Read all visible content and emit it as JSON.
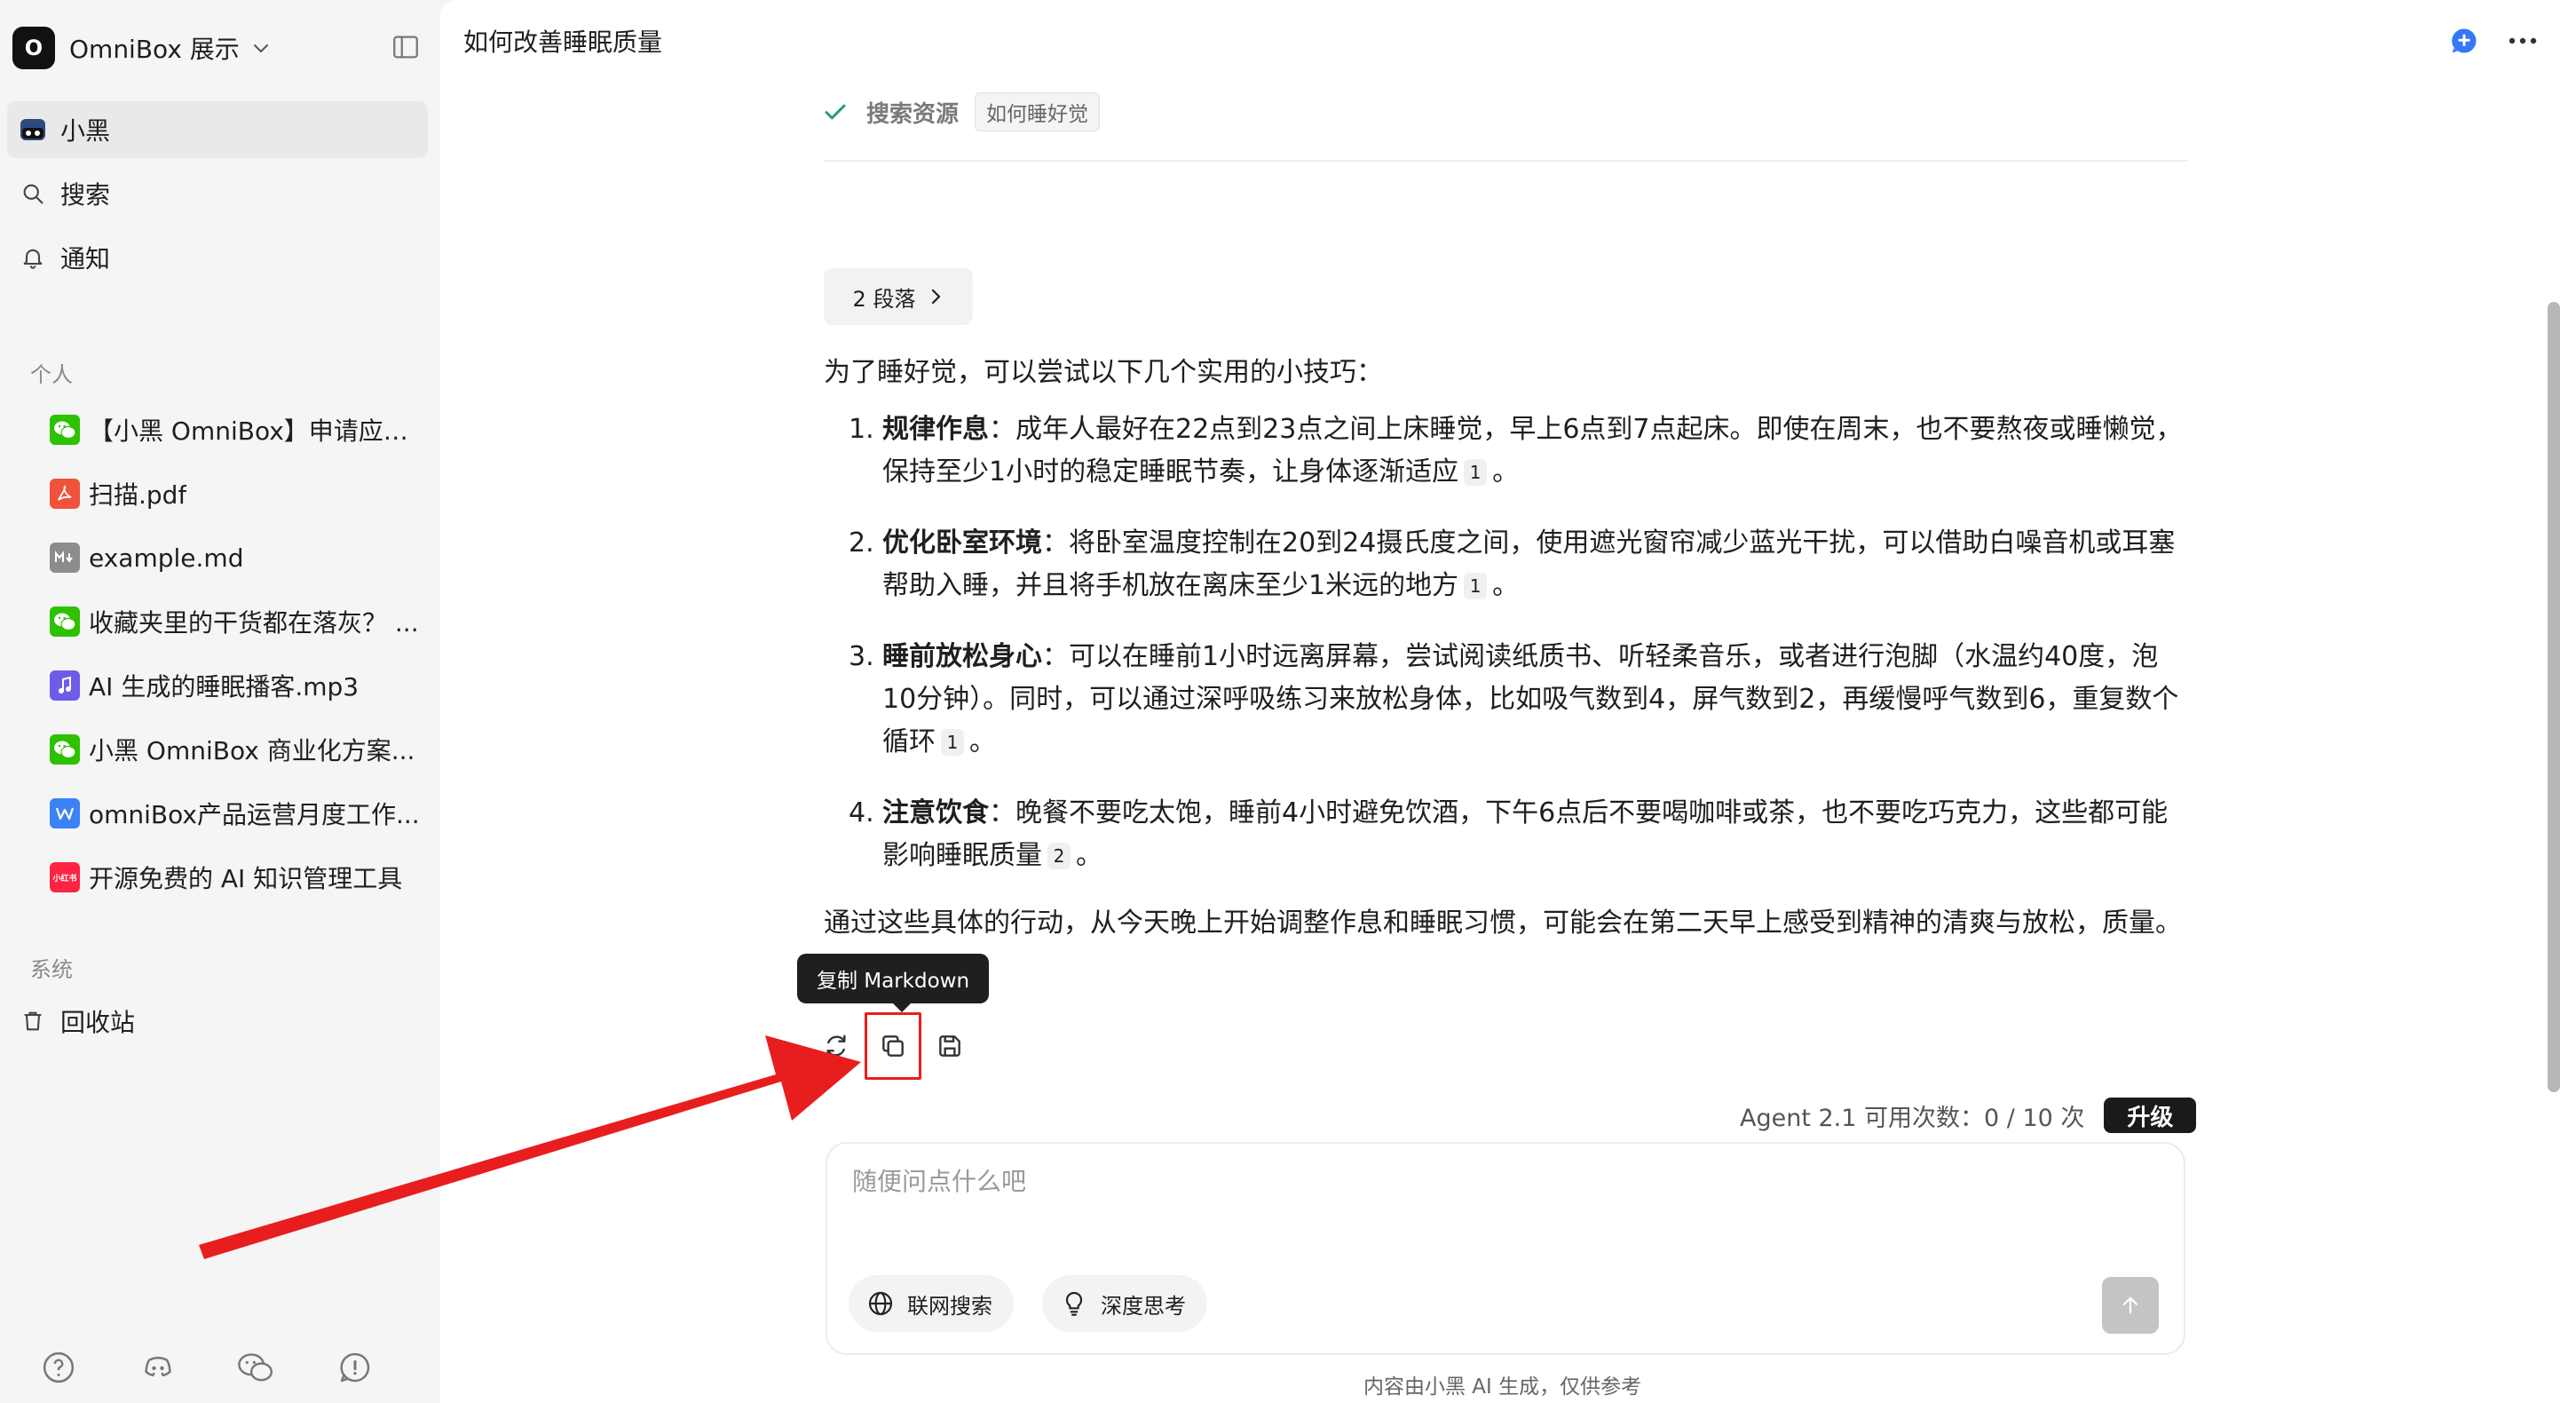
{
  "workspace": {
    "avatar_letter": "O",
    "name": "OmniBox 展示"
  },
  "nav": {
    "items": [
      {
        "label": "小黑",
        "icon": "xiaohei-avatar-icon",
        "active": true
      },
      {
        "label": "搜索",
        "icon": "search-icon"
      },
      {
        "label": "通知",
        "icon": "bell-icon"
      }
    ]
  },
  "personal": {
    "label": "个人",
    "files": [
      {
        "label": "【小黑 OmniBox】申请应聘...",
        "icon": "wechat-icon",
        "color": "#2dc100"
      },
      {
        "label": "扫描.pdf",
        "icon": "pdf-icon",
        "color": "#f0533b"
      },
      {
        "label": "example.md",
        "icon": "markdown-icon",
        "color": "#8c8c8c"
      },
      {
        "label": "收藏夹里的干货都在落灰？ ...",
        "icon": "wechat-icon",
        "color": "#2dc100"
      },
      {
        "label": "AI 生成的睡眠播客.mp3",
        "icon": "audio-icon",
        "color": "#6c5ce7"
      },
      {
        "label": "小黑 OmniBox 商业化方案...",
        "icon": "wechat-icon",
        "color": "#2dc100"
      },
      {
        "label": "omniBox产品运营月度工作...",
        "icon": "word-icon",
        "color": "#3b82f6"
      },
      {
        "label": "开源免费的 AI 知识管理工具",
        "icon": "xiaohongshu-icon",
        "color": "#ff2442",
        "badge": "小红书"
      }
    ]
  },
  "system": {
    "label": "系统",
    "trash_label": "回收站"
  },
  "main": {
    "title": "如何改善睡眠质量",
    "search": {
      "label": "搜索资源",
      "query": "如何睡好觉"
    },
    "paragraph_button": "2 段落",
    "answer": {
      "intro": "为了睡好觉，可以尝试以下几个实用的小技巧：",
      "items": [
        {
          "num": "1.",
          "title": "规律作息",
          "text": "：成年人最好在22点到23点之间上床睡觉，早上6点到7点起床。即使在周末，也不要熬夜或睡懒觉，保持至少1小时的稳定睡眠节奏，让身体逐渐适应",
          "cite": "1",
          "end": "。"
        },
        {
          "num": "2.",
          "title": "优化卧室环境",
          "text": "：将卧室温度控制在20到24摄氏度之间，使用遮光窗帘减少蓝光干扰，可以借助白噪音机或耳塞帮助入睡，并且将手机放在离床至少1米远的地方",
          "cite": "1",
          "end": "。"
        },
        {
          "num": "3.",
          "title": "睡前放松身心",
          "text": "：可以在睡前1小时远离屏幕，尝试阅读纸质书、听轻柔音乐，或者进行泡脚（水温约40度，泡10分钟）。同时，可以通过深呼吸练习来放松身体，比如吸气数到4，屏气数到2，再缓慢呼气数到6，重复数个循环",
          "cite": "1",
          "end": "。"
        },
        {
          "num": "4.",
          "title": "注意饮食",
          "text": "：晚餐不要吃太饱，睡前4小时避免饮酒，下午6点后不要喝咖啡或茶，也不要吃巧克力，这些都可能影响睡眠质量",
          "cite": "2",
          "end": "。"
        }
      ],
      "outro": "通过这些具体的行动，从今天晚上开始调整作息和睡眠习惯，可能会在第二天早上感受到精神的清爽与放松，质量。"
    },
    "tooltip": "复制 Markdown",
    "usage": {
      "text": "Agent 2.1 可用次数：0 / 10 次",
      "upgrade": "升级"
    },
    "composer": {
      "placeholder": "随便问点什么吧",
      "web_search": "联网搜索",
      "deep_think": "深度思考"
    },
    "disclaimer": "内容由小黑 AI 生成，仅供参考"
  },
  "colors": {
    "accent_blue": "#3478f6",
    "highlight_red": "#e81e1e"
  }
}
